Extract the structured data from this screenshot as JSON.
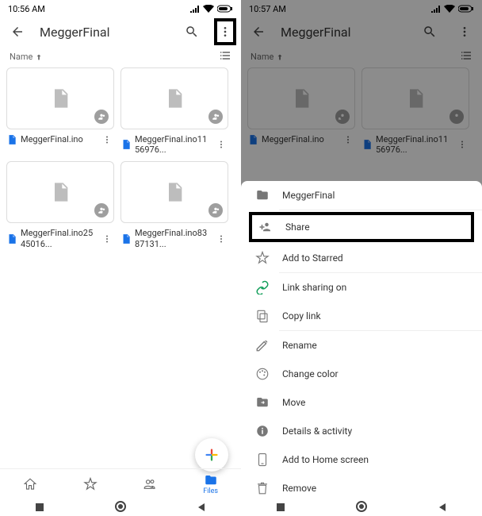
{
  "left": {
    "status_time": "10:56 AM",
    "title": "MeggerFinal",
    "sort_label": "Name",
    "files": [
      {
        "name": "MeggerFinal.ino"
      },
      {
        "name": "MeggerFinal.ino1156976..."
      },
      {
        "name": "MeggerFinal.ino2545016..."
      },
      {
        "name": "MeggerFinal.ino8387131..."
      }
    ],
    "nav_files": "Files"
  },
  "right": {
    "status_time": "10:57 AM",
    "title": "MeggerFinal",
    "sort_label": "Name",
    "files": [
      {
        "name": "MeggerFinal.ino"
      },
      {
        "name": "MeggerFinal.ino1156976..."
      }
    ],
    "sheet": {
      "folder": "MeggerFinal",
      "share": "Share",
      "starred": "Add to Starred",
      "link": "Link sharing on",
      "copy": "Copy link",
      "rename": "Rename",
      "color": "Change color",
      "move": "Move",
      "details": "Details & activity",
      "homescreen": "Add to Home screen",
      "remove": "Remove"
    }
  }
}
